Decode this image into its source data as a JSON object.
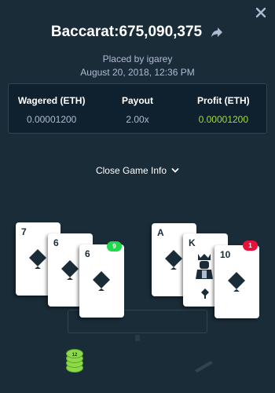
{
  "header": {
    "title": "Baccarat:675,090,375",
    "placed_by": "Placed by igarey",
    "date": "August 20, 2018, 12:36 PM"
  },
  "stats": [
    {
      "label": "Wagered (ETH)",
      "value": "0.00001200"
    },
    {
      "label": "Payout",
      "value": "2.00x"
    },
    {
      "label": "Profit (ETH)",
      "value": "0.00001200"
    }
  ],
  "toggle": {
    "label": "Close Game Info"
  },
  "player": {
    "cards": [
      {
        "rank": "7",
        "suit": "spade-icon"
      },
      {
        "rank": "6",
        "suit": "spade-icon"
      },
      {
        "rank": "6",
        "suit": "spade-icon"
      }
    ],
    "score": "9"
  },
  "banker": {
    "cards": [
      {
        "rank": "A",
        "suit": "spade-icon"
      },
      {
        "rank": "K",
        "suit": "club-icon"
      },
      {
        "rank": "10",
        "suit": "spade-icon"
      }
    ],
    "score": "1"
  },
  "chip": {
    "value": "12"
  },
  "colors": {
    "background": "#1a2c38",
    "panel": "#0f212e",
    "profit_green": "#9ddc3c",
    "player_badge": "#1fd94a",
    "banker_badge": "#e9113c"
  }
}
